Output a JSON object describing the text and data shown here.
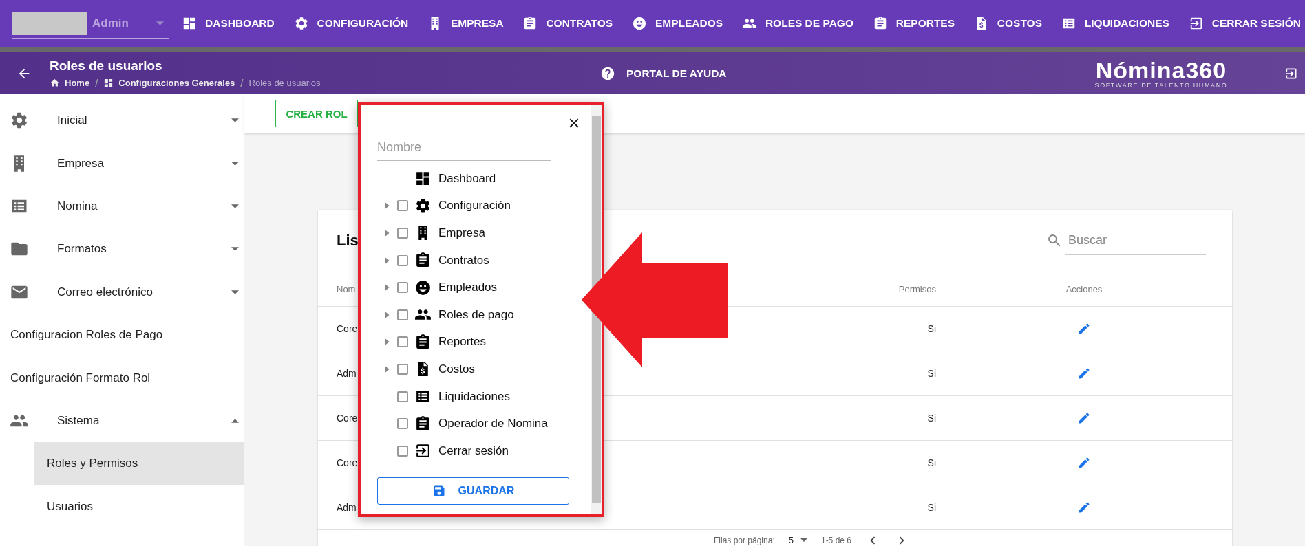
{
  "topbar": {
    "user_select": {
      "value": "Admin"
    },
    "nav": [
      {
        "label": "DASHBOARD"
      },
      {
        "label": "CONFIGURACIÓN"
      },
      {
        "label": "EMPRESA"
      },
      {
        "label": "CONTRATOS"
      },
      {
        "label": "EMPLEADOS"
      },
      {
        "label": "ROLES DE PAGO"
      },
      {
        "label": "REPORTES"
      },
      {
        "label": "COSTOS"
      },
      {
        "label": "LIQUIDACIONES"
      },
      {
        "label": "CERRAR SESIÓN"
      }
    ]
  },
  "header": {
    "title": "Roles de usuarios",
    "breadcrumb": [
      {
        "kind": "link",
        "label": "Home"
      },
      {
        "kind": "separator",
        "label": "/"
      },
      {
        "kind": "link",
        "label": "Configuraciones Generales"
      },
      {
        "kind": "separator",
        "label": "/"
      },
      {
        "kind": "current",
        "label": "Roles de usuarios"
      }
    ],
    "help_link": "PORTAL DE AYUDA",
    "logo": {
      "name": "Nómina360",
      "tagline": "SOFTWARE DE TALENTO HUMANO"
    }
  },
  "sidebar": {
    "items": [
      {
        "kind": "group",
        "label": "Inicial",
        "expanded": false,
        "selected": false
      },
      {
        "kind": "group",
        "label": "Empresa",
        "expanded": false,
        "selected": false
      },
      {
        "kind": "group",
        "label": "Nomina",
        "expanded": false,
        "selected": false
      },
      {
        "kind": "group",
        "label": "Formatos",
        "expanded": false,
        "selected": false
      },
      {
        "kind": "group",
        "label": "Correo electrónico",
        "expanded": false,
        "selected": false
      },
      {
        "kind": "link",
        "label": "Configuracion Roles de Pago",
        "selected": false
      },
      {
        "kind": "link",
        "label": "Configuración Formato Rol",
        "selected": false
      },
      {
        "kind": "group",
        "label": "Sistema",
        "expanded": true,
        "selected": false,
        "children": [
          {
            "label": "Roles y Permisos",
            "selected": true
          },
          {
            "label": "Usuarios",
            "selected": false
          }
        ]
      }
    ]
  },
  "toolbar": {
    "create_button": "CREAR ROL"
  },
  "card": {
    "title": "Lis",
    "search": {
      "placeholder": "Buscar"
    },
    "table": {
      "columns": [
        "Nom",
        "Permisos",
        "Acciones"
      ],
      "rows": [
        {
          "column_1": "Core",
          "permisos": "Si"
        },
        {
          "column_1": "Adm",
          "permisos": "Si"
        },
        {
          "column_1": "Core",
          "permisos": "Si"
        },
        {
          "column_1": "Core",
          "permisos": "Si"
        },
        {
          "column_1": "Adm",
          "permisos": "Si"
        }
      ]
    },
    "footer": {
      "rows_label": "Filas por página:",
      "rows_per_page": "5",
      "range": "1-5 de 6"
    }
  },
  "dialog": {
    "name_field": {
      "placeholder": "Nombre"
    },
    "tree": [
      {
        "label": "Dashboard",
        "expandable": false
      },
      {
        "label": "Configuración",
        "expandable": true,
        "checked": false
      },
      {
        "label": "Empresa",
        "expandable": true,
        "checked": false
      },
      {
        "label": "Contratos",
        "expandable": true,
        "checked": false
      },
      {
        "label": "Empleados",
        "expandable": true,
        "checked": false
      },
      {
        "label": "Roles de pago",
        "expandable": true,
        "checked": false
      },
      {
        "label": "Reportes",
        "expandable": true,
        "checked": false
      },
      {
        "label": "Costos",
        "expandable": true,
        "checked": false
      },
      {
        "label": "Liquidaciones",
        "expandable": false,
        "checked": false
      },
      {
        "label": "Operador de Nomina",
        "expandable": false,
        "checked": false
      },
      {
        "label": "Cerrar sesión",
        "expandable": false,
        "checked": false
      }
    ],
    "save_button": "GUARDAR"
  }
}
